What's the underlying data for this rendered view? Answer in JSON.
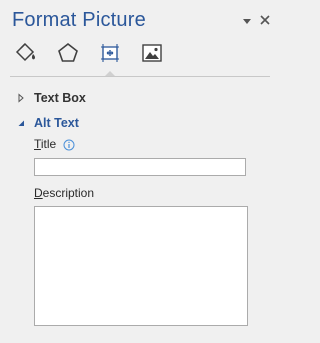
{
  "pane": {
    "title": "Format Picture"
  },
  "tabs": [
    {
      "name": "Fill & Line",
      "icon": "paint-bucket-icon"
    },
    {
      "name": "Effects",
      "icon": "pentagon-icon"
    },
    {
      "name": "Size & Properties",
      "icon": "size-properties-icon",
      "active": true
    },
    {
      "name": "Picture",
      "icon": "picture-icon"
    }
  ],
  "sections": {
    "text_box": {
      "label": "Text Box",
      "expanded": false
    },
    "alt_text": {
      "label": "Alt Text",
      "expanded": true
    }
  },
  "alt_text": {
    "title_label_mnemonic": "T",
    "title_label_rest": "itle",
    "title_value": "",
    "description_label_mnemonic": "D",
    "description_label_rest": "escription",
    "description_value": ""
  },
  "colors": {
    "accent": "#2b579a",
    "background": "#f0f0f0",
    "input_border": "#ababab",
    "info_icon": "#4a90d9"
  }
}
